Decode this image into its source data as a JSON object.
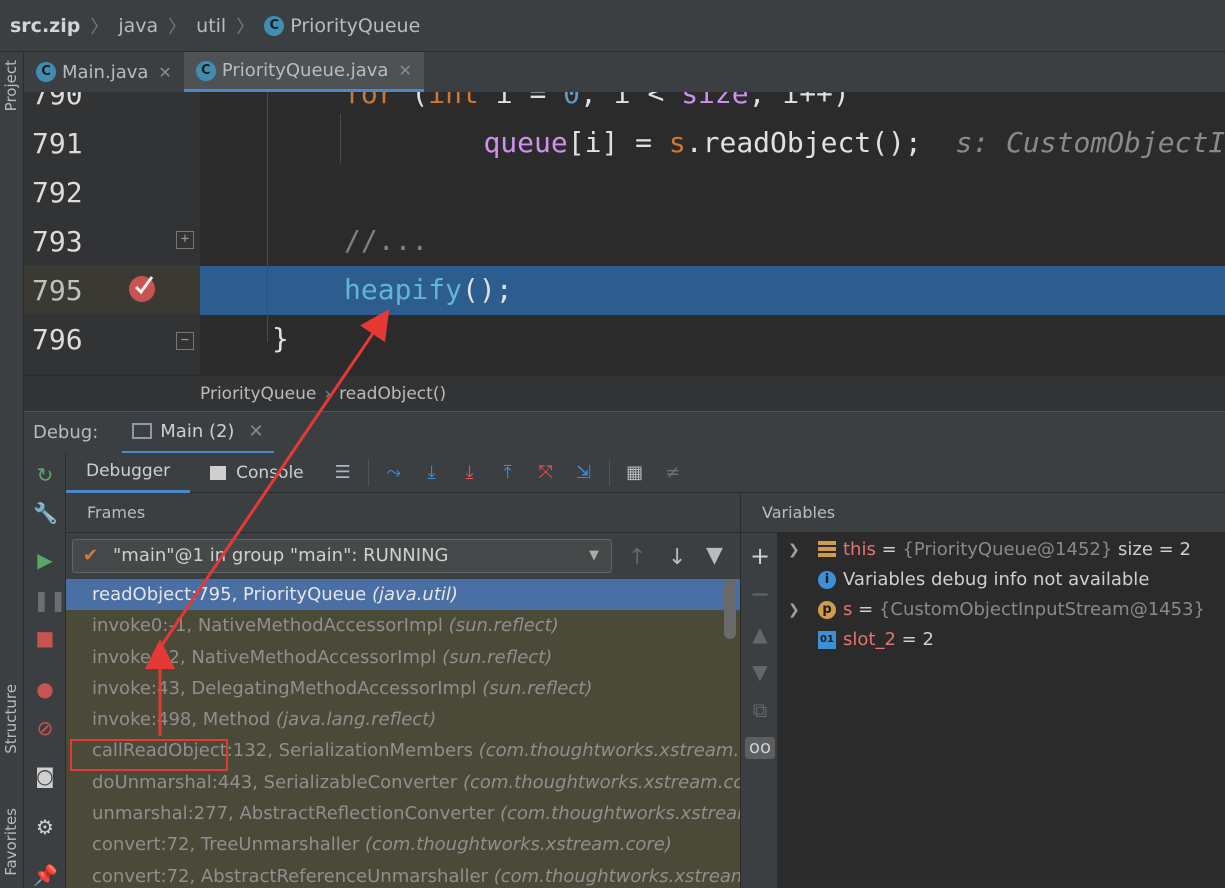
{
  "navbar": {
    "crumbs": [
      "src.zip",
      "java",
      "util",
      "PriorityQueue"
    ],
    "class_icon": "C"
  },
  "sidebar": {
    "project": "Project",
    "structure": "Structure",
    "favorites": "Favorites"
  },
  "tabs": [
    {
      "label": "Main.java",
      "icon": "C",
      "active": false
    },
    {
      "label": "PriorityQueue.java",
      "icon": "C",
      "active": true
    }
  ],
  "editor": {
    "lines": [
      {
        "num": "790",
        "tokens": [
          [
            "kw",
            "for"
          ],
          [
            "plain",
            " ("
          ],
          [
            "kw",
            "int"
          ],
          [
            "plain",
            " i = "
          ],
          [
            "num-lit",
            "0"
          ],
          [
            "plain",
            ", i < "
          ],
          [
            "var",
            "size"
          ],
          [
            "plain",
            ", i++)"
          ]
        ]
      },
      {
        "num": "791",
        "tokens": [
          [
            "plain",
            "    "
          ],
          [
            "var",
            "queue"
          ],
          [
            "plain",
            "[i] = "
          ],
          [
            "kw",
            "s"
          ],
          [
            "plain",
            "."
          ],
          [
            "plain",
            "readObject"
          ],
          [
            "plain",
            "();  "
          ],
          [
            "hint",
            "s: CustomObjectInputStream"
          ]
        ]
      },
      {
        "num": "792",
        "tokens": []
      },
      {
        "num": "793",
        "tokens": [
          [
            "cmt",
            "//..."
          ]
        ]
      },
      {
        "num": "795",
        "tokens": [
          [
            "fn",
            "heapify"
          ],
          [
            "plain",
            "();"
          ]
        ]
      },
      {
        "num": "796",
        "tokens": [
          [
            "plain",
            "}"
          ]
        ]
      }
    ],
    "highlighted_line": "795"
  },
  "breadcrumb2": [
    "PriorityQueue",
    "readObject()"
  ],
  "debug": {
    "label": "Debug:",
    "session": "Main (2)",
    "tabs": [
      "Debugger",
      "Console"
    ],
    "frames_header": "Frames",
    "variables_header": "Variables",
    "thread": "\"main\"@1 in group \"main\": RUNNING",
    "frames": [
      {
        "method": "readObject:795, PriorityQueue",
        "pkg": "(java.util)",
        "selected": true
      },
      {
        "method": "invoke0:-1, NativeMethodAccessorImpl",
        "pkg": "(sun.reflect)"
      },
      {
        "method": "invoke:62, NativeMethodAccessorImpl",
        "pkg": "(sun.reflect)"
      },
      {
        "method": "invoke:43, DelegatingMethodAccessorImpl",
        "pkg": "(sun.reflect)"
      },
      {
        "method": "invoke:498, Method",
        "pkg": "(java.lang.reflect)"
      },
      {
        "method": "callReadObject:132, SerializationMembers",
        "pkg": "(com.thoughtworks.xstream.core"
      },
      {
        "method": "doUnmarshal:443, SerializableConverter",
        "pkg": "(com.thoughtworks.xstream.conver"
      },
      {
        "method": "unmarshal:277, AbstractReflectionConverter",
        "pkg": "(com.thoughtworks.xstream.co"
      },
      {
        "method": "convert:72, TreeUnmarshaller",
        "pkg": "(com.thoughtworks.xstream.core)"
      },
      {
        "method": "convert:72, AbstractReferenceUnmarshaller",
        "pkg": "(com.thoughtworks.xstream.cor"
      }
    ],
    "variables": [
      {
        "name": "this",
        "eq": " = ",
        "value": "{PriorityQueue@1452}",
        "extra": "  size = 2",
        "expandable": true,
        "icon": "fields-icon"
      },
      {
        "info": "Variables debug info not available",
        "icon": "info-icon"
      },
      {
        "name": "s",
        "eq": " = ",
        "value": "{CustomObjectInputStream@1453}",
        "expandable": true,
        "icon": "param-icon",
        "icon_text": "p"
      },
      {
        "name": "slot_2",
        "eq": " = ",
        "value_plain": "2",
        "icon": "primitive-icon",
        "icon_text": "01"
      }
    ]
  },
  "colors": {
    "accent": "#4a88c7",
    "selection": "#2d5c8f",
    "annotation": "#e53935"
  }
}
